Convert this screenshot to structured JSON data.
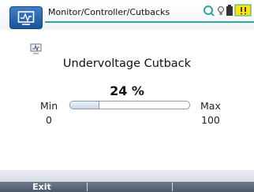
{
  "header": {
    "breadcrumb": "Monitor/Controller/Cutbacks",
    "app_icon": "monitor-waveform-icon",
    "status_icons": [
      "connection-icon",
      "bulb-icon",
      "battery-icon",
      "warning-icon"
    ]
  },
  "main": {
    "title": "Undervoltage Cutback",
    "value_text": "24 %",
    "value_fraction": 0.24,
    "min_label": "Min",
    "min_value": "0",
    "max_label": "Max",
    "max_value": "100"
  },
  "softkeys": [
    "Exit",
    "",
    ""
  ],
  "colors": {
    "accent": "#2aa7a0",
    "badge": "#1b5499",
    "softkey_bar": "#4d5968"
  }
}
